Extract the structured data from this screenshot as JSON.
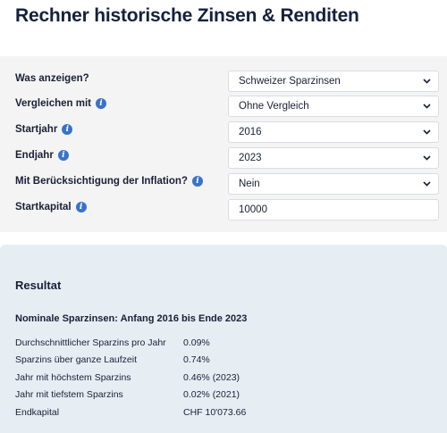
{
  "page": {
    "title": "Rechner historische Zinsen & Renditen"
  },
  "form": {
    "show": {
      "label": "Was anzeigen?",
      "value": "Schweizer Sparzinsen"
    },
    "compare": {
      "label": "Vergleichen mit",
      "value": "Ohne Vergleich"
    },
    "start_year": {
      "label": "Startjahr",
      "value": "2016"
    },
    "end_year": {
      "label": "Endjahr",
      "value": "2023"
    },
    "inflation": {
      "label": "Mit Berücksichtigung der Inflation?",
      "value": "Nein"
    },
    "start_capital": {
      "label": "Startkapital",
      "value": "10000"
    },
    "info_icon_glyph": "i"
  },
  "result": {
    "title": "Resultat",
    "subtitle": "Nominale Sparzinsen: Anfang 2016 bis Ende 2023",
    "rows": [
      {
        "label": "Durchschnittlicher Sparzins pro Jahr",
        "value": "0.09%"
      },
      {
        "label": "Sparzins über ganze Laufzeit",
        "value": "0.74%"
      },
      {
        "label": "Jahr mit höchstem Sparzins",
        "value": "0.46% (2023)"
      },
      {
        "label": "Jahr mit tiefstem Sparzins",
        "value": "0.02% (2021)"
      },
      {
        "label": "Endkapital",
        "value": "CHF 10'073.66"
      }
    ]
  },
  "colors": {
    "info_icon": "#3a72c9",
    "form_background": "#f4f4f4",
    "result_background": "#e6eef4",
    "title_text": "#14213d"
  },
  "icons": {
    "select_chevron": "chevron-down-icon",
    "info": "info-icon"
  }
}
